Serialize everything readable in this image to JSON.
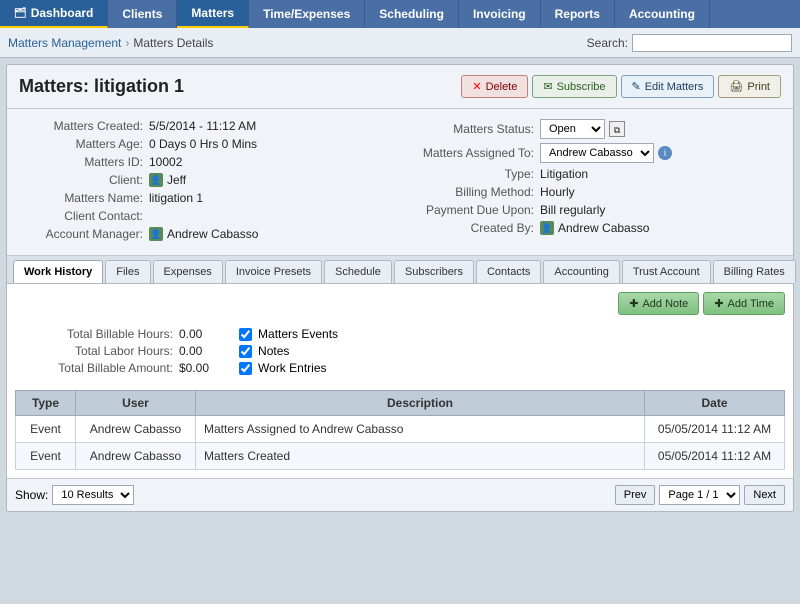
{
  "nav": {
    "items": [
      {
        "label": "Dashboard",
        "icon": "🗂",
        "active": false
      },
      {
        "label": "Clients",
        "active": false
      },
      {
        "label": "Matters",
        "active": true
      },
      {
        "label": "Time/Expenses",
        "active": false
      },
      {
        "label": "Scheduling",
        "active": false
      },
      {
        "label": "Invoicing",
        "active": false
      },
      {
        "label": "Reports",
        "active": false
      },
      {
        "label": "Accounting",
        "active": false
      }
    ]
  },
  "breadcrumb": {
    "parent": "Matters Management",
    "current": "Matters Details"
  },
  "search": {
    "label": "Search:",
    "placeholder": ""
  },
  "page": {
    "title": "Matters: litigation 1"
  },
  "action_buttons": {
    "delete": "Delete",
    "subscribe": "Subscribe",
    "edit": "Edit Matters",
    "print": "Print"
  },
  "details_left": {
    "rows": [
      {
        "label": "Matters Created:",
        "value": "5/5/2014 - 11:12 AM"
      },
      {
        "label": "Matters Age:",
        "value": "0 Days 0 Hrs 0 Mins"
      },
      {
        "label": "Matters ID:",
        "value": "10002"
      },
      {
        "label": "Client:",
        "value": "Jeff",
        "has_icon": true
      },
      {
        "label": "Matters Name:",
        "value": "litigation 1"
      },
      {
        "label": "Client Contact:",
        "value": ""
      },
      {
        "label": "Account Manager:",
        "value": "Andrew Cabasso",
        "has_icon": true
      }
    ]
  },
  "details_right": {
    "rows": [
      {
        "label": "Matters Status:",
        "value": "Open",
        "type": "select"
      },
      {
        "label": "Matters Assigned To:",
        "value": "Andrew Cabasso",
        "type": "select",
        "has_info": true
      },
      {
        "label": "Type:",
        "value": "Litigation"
      },
      {
        "label": "Billing Method:",
        "value": "Hourly"
      },
      {
        "label": "Payment Due Upon:",
        "value": "Bill regularly"
      },
      {
        "label": "Created By:",
        "value": "Andrew Cabasso",
        "has_icon": true
      }
    ]
  },
  "tabs": [
    {
      "label": "Work History",
      "active": true
    },
    {
      "label": "Files",
      "active": false
    },
    {
      "label": "Expenses",
      "active": false
    },
    {
      "label": "Invoice Presets",
      "active": false
    },
    {
      "label": "Schedule",
      "active": false
    },
    {
      "label": "Subscribers",
      "active": false
    },
    {
      "label": "Contacts",
      "active": false
    },
    {
      "label": "Accounting",
      "active": false
    },
    {
      "label": "Trust Account",
      "active": false
    },
    {
      "label": "Billing Rates",
      "active": false
    }
  ],
  "tab_toolbar": {
    "add_note": "Add Note",
    "add_time": "Add Time"
  },
  "totals": [
    {
      "label": "Total Billable Hours:",
      "value": "0.00"
    },
    {
      "label": "Total Labor Hours:",
      "value": "0.00"
    },
    {
      "label": "Total Billable Amount:",
      "value": "$0.00"
    }
  ],
  "filters": [
    {
      "label": "Matters Events",
      "checked": true
    },
    {
      "label": "Notes",
      "checked": true
    },
    {
      "label": "Work Entries",
      "checked": true
    }
  ],
  "table": {
    "headers": [
      "Type",
      "User",
      "Description",
      "Date"
    ],
    "rows": [
      {
        "type": "Event",
        "user": "Andrew Cabasso",
        "description": "Matters Assigned to Andrew Cabasso",
        "date": "05/05/2014 11:12 AM"
      },
      {
        "type": "Event",
        "user": "Andrew Cabasso",
        "description": "Matters Created",
        "date": "05/05/2014 11:12 AM"
      }
    ]
  },
  "pagination": {
    "show_label": "Show:",
    "show_value": "10 Results",
    "prev": "Prev",
    "page_info": "Page 1 / 1",
    "next": "Next"
  }
}
